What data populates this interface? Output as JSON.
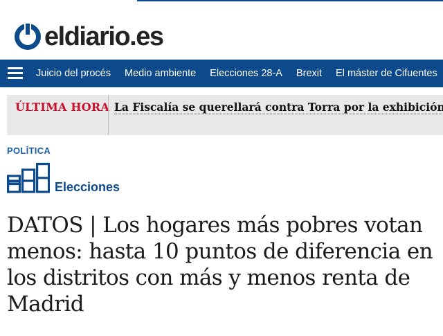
{
  "header": {
    "logo_text": "eldiario.es"
  },
  "navbar": {
    "items": [
      {
        "label": "Juicio del procés"
      },
      {
        "label": "Medio ambiente"
      },
      {
        "label": "Elecciones 28-A"
      },
      {
        "label": "Brexit"
      },
      {
        "label": "El máster de Cifuentes"
      }
    ]
  },
  "breaking": {
    "label": "ÚLTIMA HORA",
    "text": "La Fiscalía se querellará contra Torra por la exhibición de lazos amarillos"
  },
  "article": {
    "section": "POLÍTICA",
    "tag": "Elecciones",
    "headline": "DATOS | Los hogares más pobres votan menos: hasta 10 puntos de diferencia en los distritos con más y menos renta de Madrid"
  },
  "colors": {
    "brand_blue": "#0d4a8c",
    "breaking_red": "#c8102e",
    "section_blue": "#1d5fa8"
  }
}
